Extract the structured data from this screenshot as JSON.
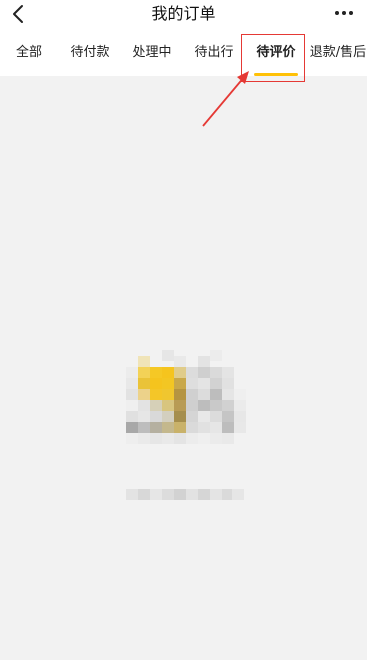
{
  "header": {
    "title": "我的订单",
    "back_icon": "chevron-left-icon",
    "more_icon": "more-horizontal-icon"
  },
  "tabs": [
    {
      "label": "全部",
      "selected": false
    },
    {
      "label": "待付款",
      "selected": false
    },
    {
      "label": "处理中",
      "selected": false
    },
    {
      "label": "待出行",
      "selected": false
    },
    {
      "label": "待评价",
      "selected": true
    },
    {
      "label": "退款/售后",
      "selected": false
    }
  ],
  "colors": {
    "accent": "#ffc107",
    "annotation": "#e53935",
    "background": "#f2f2f2"
  },
  "empty_state": {
    "icon": "empty-orders-icon"
  }
}
